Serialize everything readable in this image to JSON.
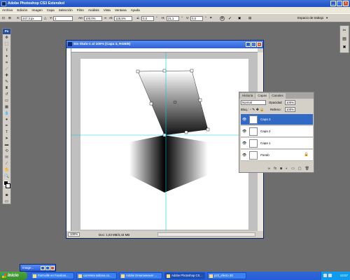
{
  "app": {
    "title": "Adobe Photoshop CS3 Extended"
  },
  "menu": [
    "Archivo",
    "Edición",
    "Imagen",
    "Capa",
    "Selección",
    "Filtro",
    "Análisis",
    "Vista",
    "Ventana",
    "Ayuda"
  ],
  "options": {
    "x": "247,3 px",
    "y": "1",
    "w": "100,0%",
    "h": "125,5%",
    "angle": "0,0",
    "h_skew": "21,1",
    "v_skew": "0,0",
    "workspace": "Espacio de trabajo"
  },
  "document": {
    "title": "Sin título-1 al 100% (Capa 3, RGB/8)",
    "zoom": "100%",
    "doc_info": "Doc: 1,03 MB/3,43 MB"
  },
  "layers_panel": {
    "tabs": [
      "Historia",
      "Capas",
      "Canales"
    ],
    "active_tab": "Capas",
    "blend_mode": "Normal",
    "opacity_label": "Opacidad:",
    "opacity": "100%",
    "lock_label": "Bloq.:",
    "fill_label": "Relleno:",
    "fill": "100%",
    "layers": [
      {
        "name": "Capa 3",
        "selected": true
      },
      {
        "name": "Capa 2",
        "selected": false
      },
      {
        "name": "Capa 1",
        "selected": false
      },
      {
        "name": "Fondo",
        "selected": false
      }
    ]
  },
  "minimized_window": {
    "title": "Image..."
  },
  "taskbar": {
    "start": "Inicio",
    "tasks": [
      "Farmville en Faceboo...",
      "carretera sultana co...",
      "Adobe Dreamweaver ...",
      "Adobe Photoshop CS...",
      "p23_efecto 3D"
    ],
    "active_task": 3,
    "clock": "13:07"
  }
}
